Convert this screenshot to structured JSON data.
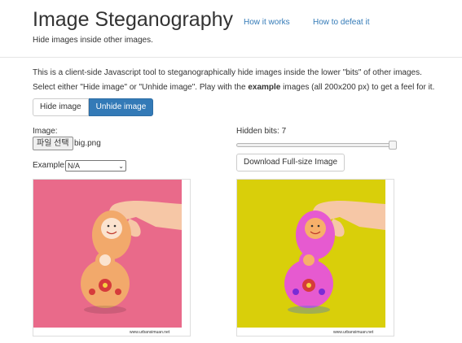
{
  "header": {
    "title": "Image Steganography",
    "nav": [
      "How it works",
      "How to defeat it"
    ],
    "subtitle": "Hide images inside other images."
  },
  "intro": {
    "line1": "This is a client-side Javascript tool to steganographically hide images inside the lower \"bits\" of other images.",
    "line2_before": "Select either \"Hide image\" or \"Unhide image\". Play with the ",
    "line2_bold": "example",
    "line2_after": " images (all 200x200 px) to get a feel for it."
  },
  "mode_buttons": {
    "hide": "Hide image",
    "unhide": "Unhide image",
    "active": "unhide"
  },
  "image_input": {
    "label": "Image:",
    "button": "파일 선택",
    "filename": "big.png"
  },
  "example": {
    "label": "Example:",
    "selected": "N/A"
  },
  "hidden_bits": {
    "label": "Hidden bits: 7",
    "value": 7,
    "max": 7
  },
  "download_button": "Download Full-size Image",
  "images": {
    "left": {
      "background": "#e96a8a",
      "doll_color": "#f2a96b",
      "footer": "www.urbansimuan.net"
    },
    "right": {
      "background": "#d9cf0a",
      "doll_color": "#e65ad0",
      "footer": "www.urbansimuan.net"
    }
  },
  "colors": {
    "accent": "#337ab7",
    "link": "#337ab7"
  }
}
